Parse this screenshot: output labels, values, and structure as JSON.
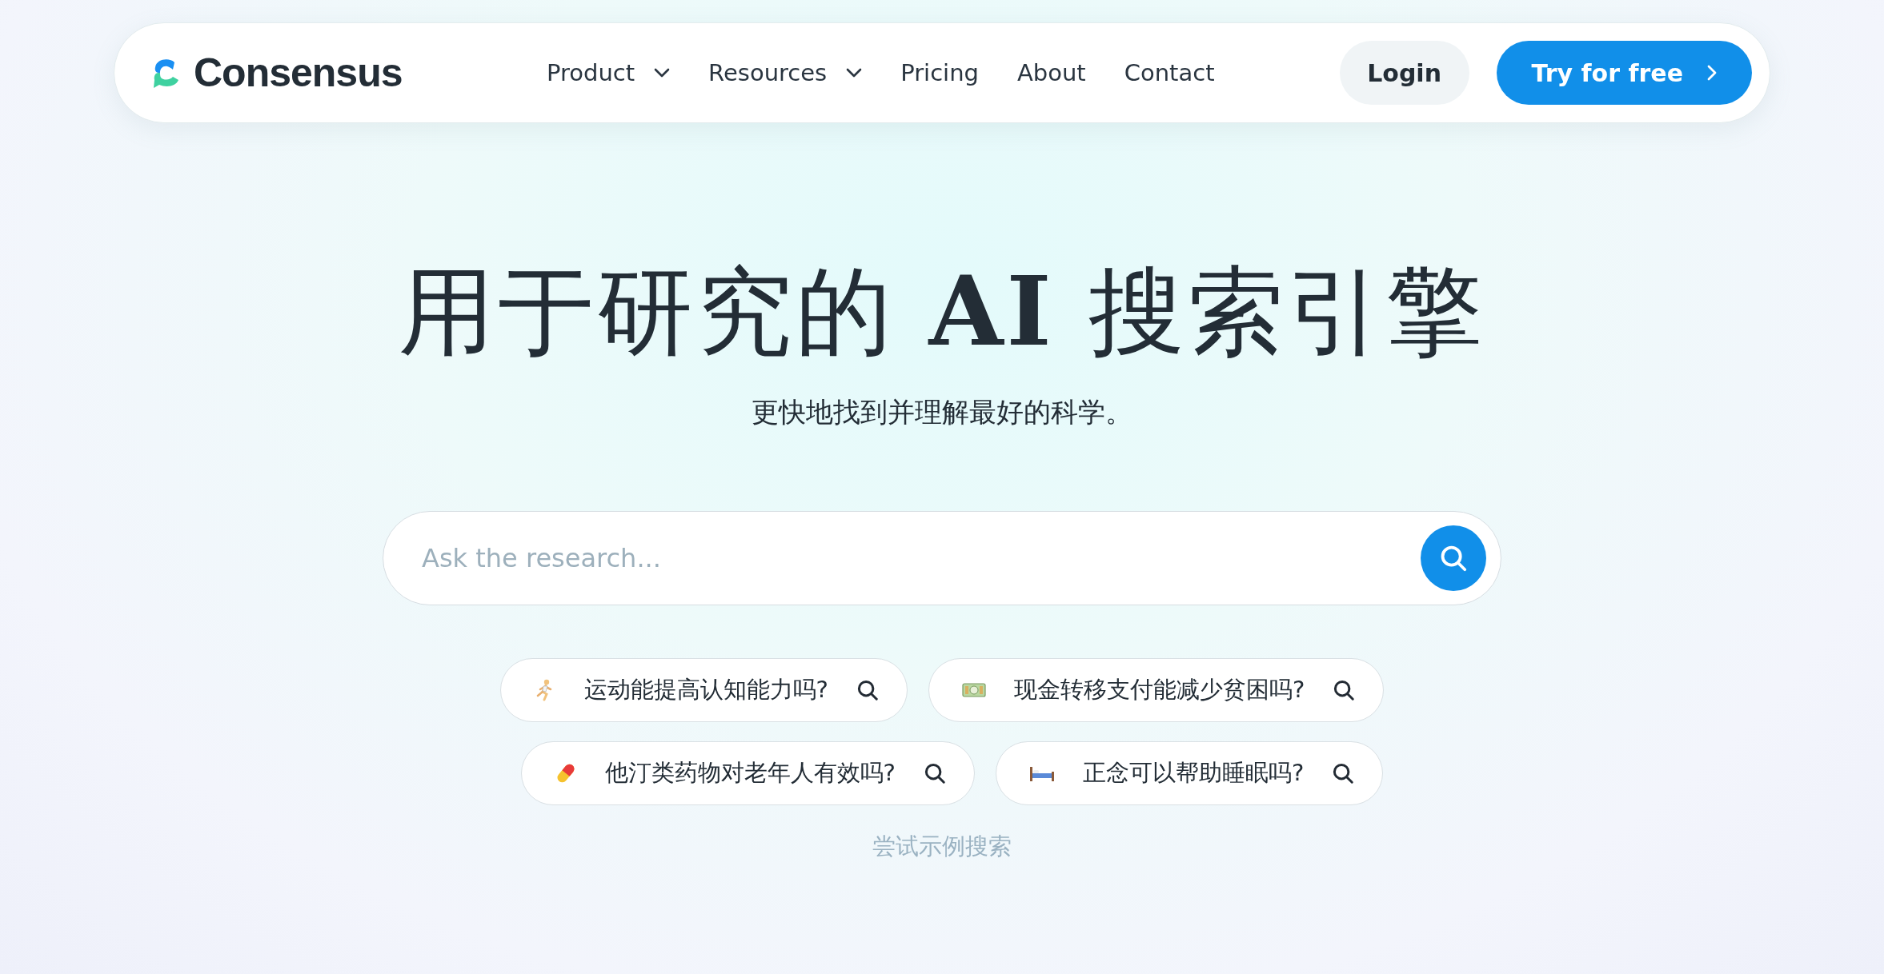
{
  "navbar": {
    "logo": "Consensus",
    "links": [
      {
        "label": "Product",
        "dropdown": true
      },
      {
        "label": "Resources",
        "dropdown": true
      },
      {
        "label": "Pricing",
        "dropdown": false
      },
      {
        "label": "About",
        "dropdown": false
      },
      {
        "label": "Contact",
        "dropdown": false
      }
    ],
    "login": "Login",
    "cta": "Try for free"
  },
  "hero": {
    "headline": "用于研究的 **AI** 搜索引擎",
    "subtitle": "更快地找到并理解最好的科学。"
  },
  "search": {
    "placeholder": "Ask the research..."
  },
  "examples": [
    {
      "text": "运动能提高认知能力吗?"
    },
    {
      "text": "现金转移支付能减少贫困吗?"
    },
    {
      "text": "他汀类药物对老年人有效吗?"
    },
    {
      "text": "正念可以帮助睡眠吗?"
    }
  ],
  "examples_caption": "尝试示例搜索"
}
